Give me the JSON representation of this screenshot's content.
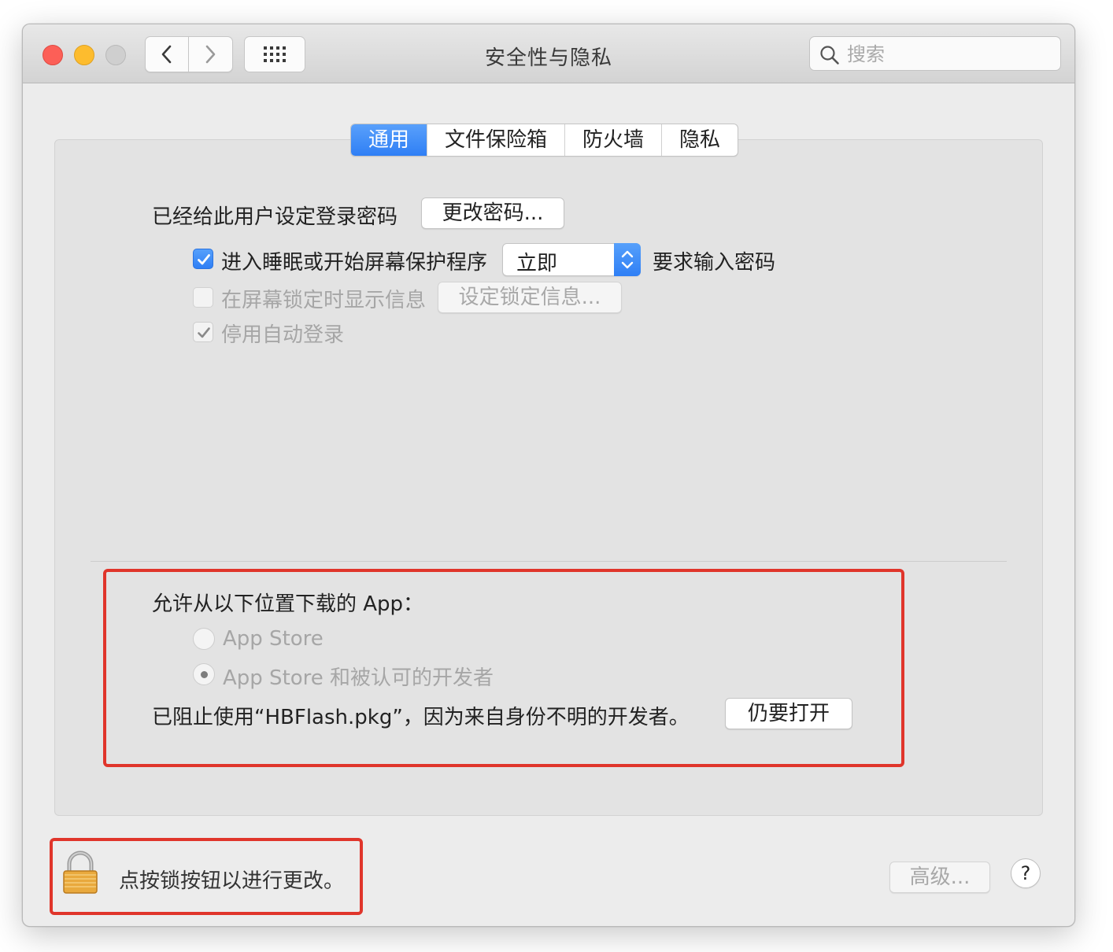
{
  "window": {
    "title": "安全性与隐私"
  },
  "search": {
    "placeholder": "搜索"
  },
  "tabs": [
    {
      "label": "通用",
      "active": true
    },
    {
      "label": "文件保险箱",
      "active": false
    },
    {
      "label": "防火墙",
      "active": false
    },
    {
      "label": "隐私",
      "active": false
    }
  ],
  "general": {
    "login_password_label": "已经给此用户设定登录密码",
    "change_password_button": "更改密码...",
    "require_password": {
      "checked": true,
      "label": "进入睡眠或开始屏幕保护程序",
      "delay_value": "立即",
      "suffix": "要求输入密码"
    },
    "lock_message": {
      "checked": false,
      "label": "在屏幕锁定时显示信息",
      "button": "设定锁定信息..."
    },
    "disable_auto_login": {
      "checked": true,
      "label": "停用自动登录"
    }
  },
  "downloads": {
    "heading": "允许从以下位置下载的 App：",
    "options": [
      {
        "label": "App Store",
        "selected": false
      },
      {
        "label": "App Store 和被认可的开发者",
        "selected": true
      }
    ],
    "blocked_message": "已阻止使用“HBFlash.pkg”，因为来自身份不明的开发者。",
    "open_anyway_button": "仍要打开"
  },
  "footer": {
    "lock_text": "点按锁按钮以进行更改。",
    "advanced_button": "高级...",
    "help_label": "?"
  },
  "colors": {
    "accent": "#2f7ff5",
    "highlight_box": "#e0352b"
  }
}
